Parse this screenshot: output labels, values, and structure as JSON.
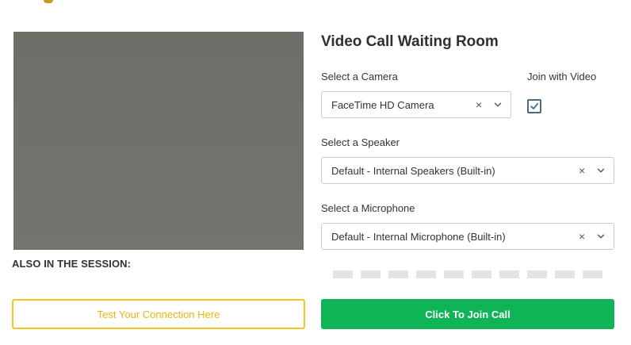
{
  "title": "Video Call Waiting Room",
  "session": {
    "also_in_session_label": "ALSO IN THE SESSION:"
  },
  "camera": {
    "label": "Select a Camera",
    "selected": "FaceTime HD Camera"
  },
  "join_with_video": {
    "label": "Join with Video",
    "checked": true
  },
  "speaker": {
    "label": "Select a Speaker",
    "selected": "Default - Internal Speakers (Built-in)"
  },
  "microphone": {
    "label": "Select a Microphone",
    "selected": "Default - Internal Microphone (Built-in)",
    "level_segments_total": 10,
    "level_segments_active": 0
  },
  "buttons": {
    "test_connection": "Test Your Connection Here",
    "join_call": "Click To Join Call"
  },
  "colors": {
    "join_button": "#0fb457",
    "test_button_border": "#f3c51f",
    "test_button_text": "#e8b516",
    "checkbox": "#4a6a84",
    "video_preview": "#71706b"
  },
  "icons": {
    "clear": "×",
    "chevron": "chevron-down-icon",
    "checkbox": "checkmark-icon"
  }
}
